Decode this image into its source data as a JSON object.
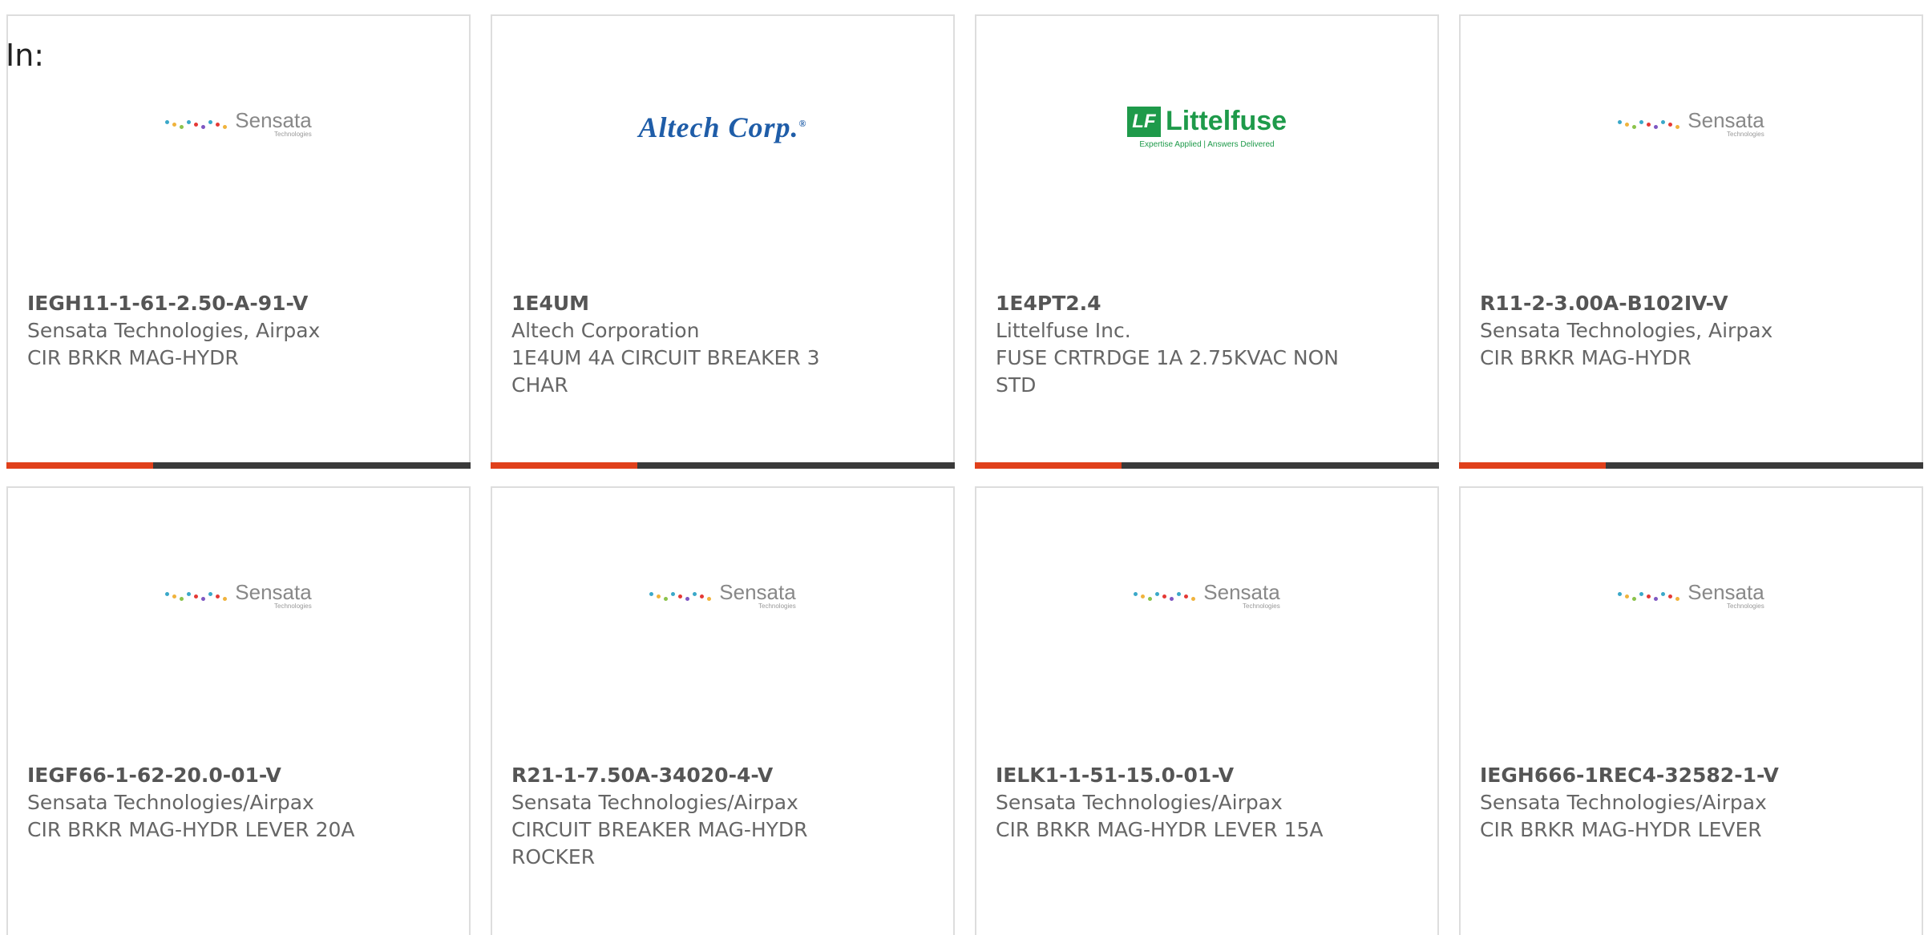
{
  "page": {
    "label": "In:"
  },
  "colors": {
    "accent": "#e0401b",
    "bar": "#3a3a3a",
    "sensata_dots": [
      "#3aa8c9",
      "#f0b33c",
      "#8bc34a",
      "#e53935",
      "#7e57c2"
    ],
    "altech_blue": "#1f5da8",
    "littelfuse_green": "#1e9a4a"
  },
  "logos": {
    "sensata": {
      "name": "Sensata",
      "sub": "Technologies"
    },
    "altech": {
      "name": "Altech Corp.",
      "reg": "®"
    },
    "littelfuse": {
      "badge": "LF",
      "name": "Littelfuse",
      "tagline": "Expertise Applied | Answers Delivered"
    }
  },
  "cards": [
    {
      "logo": "sensata",
      "part_number": "IEGH11-1-61-2.50-A-91-V",
      "manufacturer": "Sensata Technologies, Airpax",
      "description": "CIR BRKR MAG-HYDR"
    },
    {
      "logo": "altech",
      "part_number": "1E4UM",
      "manufacturer": "Altech Corporation",
      "description": "1E4UM 4A CIRCUIT BREAKER 3 CHAR"
    },
    {
      "logo": "littelfuse",
      "part_number": "1E4PT2.4",
      "manufacturer": "Littelfuse Inc.",
      "description": "FUSE CRTRDGE 1A 2.75KVAC NON STD"
    },
    {
      "logo": "sensata",
      "part_number": "R11-2-3.00A-B102IV-V",
      "manufacturer": "Sensata Technologies, Airpax",
      "description": "CIR BRKR MAG-HYDR"
    },
    {
      "logo": "sensata",
      "part_number": "IEGF66-1-62-20.0-01-V",
      "manufacturer": "Sensata Technologies/Airpax",
      "description": "CIR BRKR MAG-HYDR LEVER 20A"
    },
    {
      "logo": "sensata",
      "part_number": "R21-1-7.50A-34020-4-V",
      "manufacturer": "Sensata Technologies/Airpax",
      "description": "CIRCUIT BREAKER MAG-HYDR ROCKER"
    },
    {
      "logo": "sensata",
      "part_number": "IELK1-1-51-15.0-01-V",
      "manufacturer": "Sensata Technologies/Airpax",
      "description": "CIR BRKR MAG-HYDR LEVER 15A"
    },
    {
      "logo": "sensata",
      "part_number": "IEGH666-1REC4-32582-1-V",
      "manufacturer": "Sensata Technologies/Airpax",
      "description": "CIR BRKR MAG-HYDR LEVER"
    }
  ]
}
